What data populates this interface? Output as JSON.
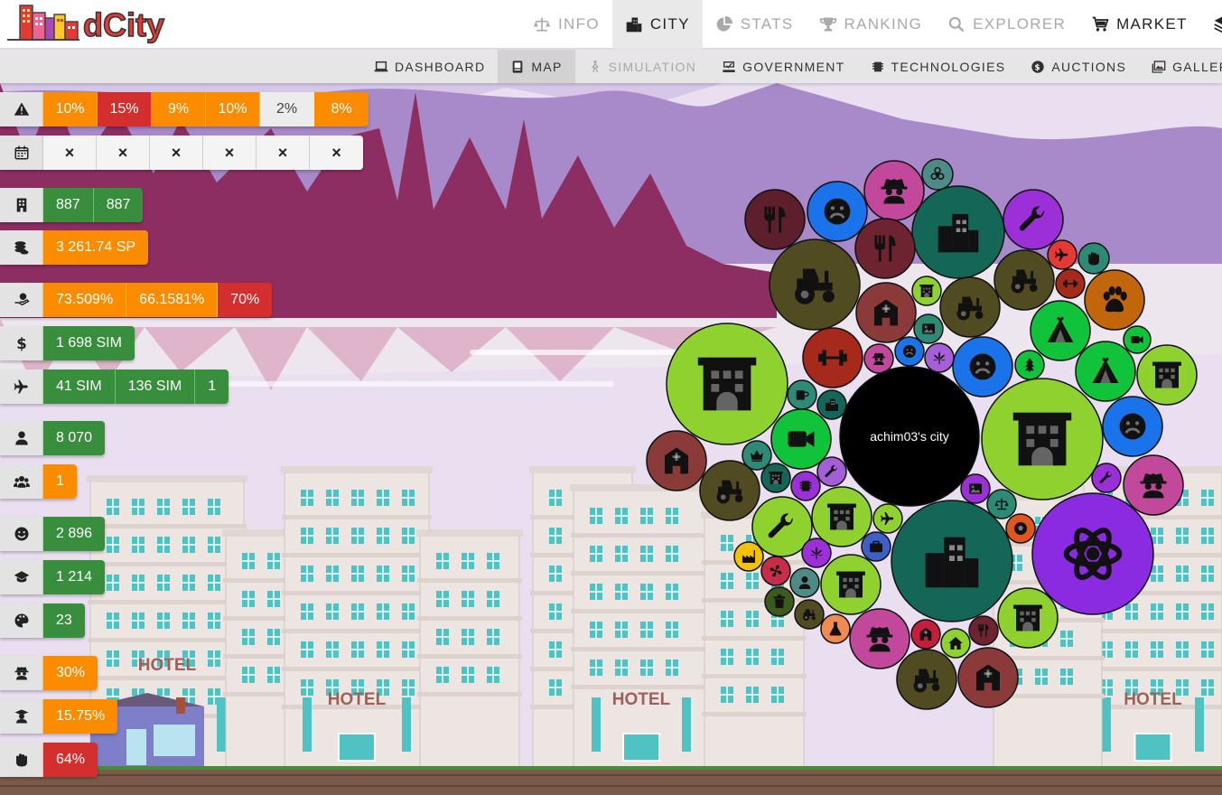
{
  "app": {
    "logo_text": "dCity"
  },
  "nav": {
    "main_tabs": [
      {
        "id": "info",
        "label": "INFO",
        "icon": "scale-icon",
        "state": "muted"
      },
      {
        "id": "city",
        "label": "CITY",
        "icon": "city-icon",
        "state": "active"
      },
      {
        "id": "stats",
        "label": "STATS",
        "icon": "pie-chart-icon",
        "state": "muted"
      },
      {
        "id": "ranking",
        "label": "RANKING",
        "icon": "trophy-icon",
        "state": "muted"
      },
      {
        "id": "explorer",
        "label": "EXPLORER",
        "icon": "search-icon",
        "state": "muted"
      },
      {
        "id": "market",
        "label": "MARKET",
        "icon": "cart-icon",
        "state": "dark"
      }
    ],
    "sub_tabs": [
      {
        "id": "dashboard",
        "label": "DASHBOARD",
        "icon": "laptop-icon",
        "state": "normal"
      },
      {
        "id": "map",
        "label": "MAP",
        "icon": "map-icon",
        "state": "active"
      },
      {
        "id": "simulation",
        "label": "SIMULATION",
        "icon": "simulation-icon",
        "state": "disabled"
      },
      {
        "id": "government",
        "label": "GOVERNMENT",
        "icon": "government-icon",
        "state": "normal"
      },
      {
        "id": "technologies",
        "label": "TECHNOLOGIES",
        "icon": "chip-icon",
        "state": "normal"
      },
      {
        "id": "auctions",
        "label": "AUCTIONS",
        "icon": "coin-icon",
        "state": "normal"
      },
      {
        "id": "gallery",
        "label": "GALLERY",
        "icon": "gallery-icon",
        "state": "normal"
      }
    ]
  },
  "stats": [
    {
      "icon": "warning-icon",
      "cells": [
        {
          "text": "10%",
          "color": "orange"
        },
        {
          "text": "15%",
          "color": "red"
        },
        {
          "text": "9%",
          "color": "orange"
        },
        {
          "text": "10%",
          "color": "orange"
        },
        {
          "text": "2%",
          "color": "light"
        },
        {
          "text": "8%",
          "color": "orange"
        }
      ]
    },
    {
      "icon": "calendar-icon",
      "cells": [
        {
          "text": "×",
          "color": "x"
        },
        {
          "text": "×",
          "color": "x"
        },
        {
          "text": "×",
          "color": "x"
        },
        {
          "text": "×",
          "color": "x"
        },
        {
          "text": "×",
          "color": "x"
        },
        {
          "text": "×",
          "color": "x"
        }
      ]
    },
    {
      "icon": "building-icon",
      "cells": [
        {
          "text": "887",
          "color": "green"
        },
        {
          "text": "887",
          "color": "green"
        }
      ]
    },
    {
      "icon": "coins-icon",
      "cells": [
        {
          "text": "3 261.74 SP",
          "color": "orange"
        }
      ]
    },
    {
      "icon": "hand-money-icon",
      "cells": [
        {
          "text": "73.509%",
          "color": "orange"
        },
        {
          "text": "66.1581%",
          "color": "orange"
        },
        {
          "text": "70%",
          "color": "red"
        }
      ]
    },
    {
      "icon": "dollar-icon",
      "cells": [
        {
          "text": "1 698 SIM",
          "color": "green"
        }
      ]
    },
    {
      "icon": "plane-icon",
      "cells": [
        {
          "text": "41 SIM",
          "color": "green"
        },
        {
          "text": "136 SIM",
          "color": "green"
        },
        {
          "text": "1",
          "color": "green"
        }
      ]
    },
    {
      "icon": "user-icon",
      "cells": [
        {
          "text": "8 070",
          "color": "green"
        }
      ]
    },
    {
      "icon": "users-icon",
      "cells": [
        {
          "text": "1",
          "color": "orange"
        }
      ]
    },
    {
      "icon": "smile-icon",
      "cells": [
        {
          "text": "2 896",
          "color": "green"
        }
      ]
    },
    {
      "icon": "graduation-cap-icon",
      "cells": [
        {
          "text": "1 214",
          "color": "green"
        }
      ]
    },
    {
      "icon": "palette-icon",
      "cells": [
        {
          "text": "23",
          "color": "green"
        }
      ]
    },
    {
      "icon": "spy-icon",
      "cells": [
        {
          "text": "30%",
          "color": "orange"
        }
      ]
    },
    {
      "icon": "teacher-icon",
      "cells": [
        {
          "text": "15.75%",
          "color": "orange"
        }
      ]
    },
    {
      "icon": "fist-icon",
      "cells": [
        {
          "text": "64%",
          "color": "red"
        }
      ]
    }
  ],
  "map": {
    "center_label": "achim03's city",
    "bubbles": [
      {
        "icon": "restaurant-icon",
        "color": "#5c1f2b"
      },
      {
        "icon": "sad-face-icon",
        "color": "#1a73e8"
      },
      {
        "icon": "spy-icon",
        "color": "#c2489b"
      },
      {
        "icon": "biohazard-icon",
        "color": "#4e8a86"
      },
      {
        "icon": "city-icon",
        "color": "#146656"
      },
      {
        "icon": "wrench-icon",
        "color": "#9b30d9"
      },
      {
        "icon": "restaurant-icon",
        "color": "#6d2430"
      },
      {
        "icon": "tractor-icon",
        "color": "#514b22"
      },
      {
        "icon": "tractor-icon",
        "color": "#514b22"
      },
      {
        "icon": "plane-icon",
        "color": "#e53935"
      },
      {
        "icon": "fist-icon",
        "color": "#2d8a74"
      },
      {
        "icon": "dumbbell-icon",
        "color": "#a52a1c"
      },
      {
        "icon": "paw-icon",
        "color": "#c2660c"
      },
      {
        "icon": "hospital-icon",
        "color": "#8b3a3a"
      },
      {
        "icon": "hotel-icon",
        "color": "#8fd12e"
      },
      {
        "icon": "tractor-icon",
        "color": "#514b22"
      },
      {
        "icon": "tent-icon",
        "color": "#11c33a"
      },
      {
        "icon": "image-icon",
        "color": "#2d8a74"
      },
      {
        "icon": "tent-icon",
        "color": "#11c33a"
      },
      {
        "icon": "video-icon",
        "color": "#11c33a"
      },
      {
        "icon": "hotel-icon",
        "color": "#8fd12e"
      },
      {
        "icon": "hospital-icon",
        "color": "#8b3a3a"
      },
      {
        "icon": "dumbbell-icon",
        "color": "#a52a1c"
      },
      {
        "icon": "spy-icon",
        "color": "#c2489b"
      },
      {
        "icon": "sad-face-icon",
        "color": "#1a73e8"
      },
      {
        "icon": "cannabis-icon",
        "color": "#a55fd6"
      },
      {
        "icon": "sad-face-icon",
        "color": "#1a73e8"
      },
      {
        "icon": "tree-icon",
        "color": "#11c33a"
      },
      {
        "icon": "tent-icon",
        "color": "#11c33a"
      },
      {
        "icon": "tent-icon",
        "color": "#11c33a"
      },
      {
        "icon": "mug-icon",
        "color": "#2d8a74"
      },
      {
        "icon": "city-icon",
        "color": "#146656"
      },
      {
        "icon": "video-icon",
        "color": "#11c33a"
      },
      {
        "icon": "hotel-icon",
        "color": "#8fd12e"
      },
      {
        "icon": "sad-face-icon",
        "color": "#1a73e8"
      },
      {
        "icon": "hotel-icon",
        "color": "#8fd12e"
      },
      {
        "icon": "crown-icon",
        "color": "#2d8a74"
      },
      {
        "icon": "tractor-icon",
        "color": "#514b22"
      },
      {
        "icon": "hotel-icon",
        "color": "#146656"
      },
      {
        "icon": "chip-icon",
        "color": "#9b30d9"
      },
      {
        "icon": "wrench-icon",
        "color": "#a55fd6"
      },
      {
        "icon": "wrench-icon",
        "color": "#8fd12e"
      },
      {
        "icon": "spy-icon",
        "color": "#c2489b"
      },
      {
        "icon": "image-icon",
        "color": "#9b30d9"
      },
      {
        "icon": "scale-icon",
        "color": "#2d8a74"
      },
      {
        "icon": "wrench-icon",
        "color": "#9b30d9"
      },
      {
        "icon": "hotel-icon",
        "color": "#8fd12e"
      },
      {
        "icon": "plane-icon",
        "color": "#8fd12e"
      },
      {
        "icon": "soccer-icon",
        "color": "#e0561c"
      },
      {
        "icon": "atom-icon",
        "color": "#8a2be2"
      },
      {
        "icon": "factory-icon",
        "color": "#f2c200"
      },
      {
        "icon": "cannabis-icon",
        "color": "#9b30d9"
      },
      {
        "icon": "briefcase-icon",
        "color": "#3c5fc8"
      },
      {
        "icon": "city-icon",
        "color": "#146656"
      },
      {
        "icon": "fan-icon",
        "color": "#c72c48"
      },
      {
        "icon": "user-icon",
        "color": "#4e8a86"
      },
      {
        "icon": "hotel-icon",
        "color": "#8fd12e"
      },
      {
        "icon": "trash-icon",
        "color": "#3d5a1e"
      },
      {
        "icon": "tractor-icon",
        "color": "#514b22"
      },
      {
        "icon": "flask-icon",
        "color": "#f08a50"
      },
      {
        "icon": "spy-icon",
        "color": "#c2489b"
      },
      {
        "icon": "hospital-icon",
        "color": "#c41e3a"
      },
      {
        "icon": "home-icon",
        "color": "#8fd12e"
      },
      {
        "icon": "restaurant-icon",
        "color": "#6d2430"
      },
      {
        "icon": "hotel-icon",
        "color": "#8fd12e"
      },
      {
        "icon": "tractor-icon",
        "color": "#514b22"
      },
      {
        "icon": "hospital-icon",
        "color": "#8b3a3a"
      },
      {
        "icon": "hospital-icon",
        "color": "#8b3a3a"
      }
    ]
  },
  "scene": {
    "hotel_sign": "HOTEL",
    "colors": {
      "sky": "#e9dff0",
      "mountain_far": "#a889c9",
      "mountain_near": "#8c2e62",
      "building": "#ece5e1",
      "window": "#4fc3c3",
      "ground": "#7a5a4a"
    }
  }
}
